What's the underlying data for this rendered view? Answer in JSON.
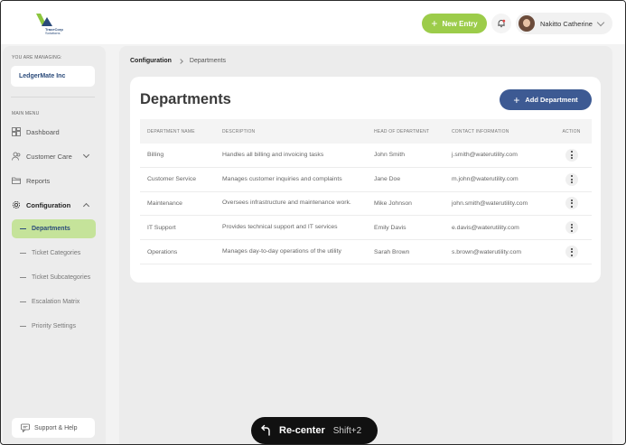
{
  "header": {
    "logo_name": "TraceCorp",
    "logo_tagline": "Solutions",
    "new_entry_label": "New Entry",
    "user_name": "Nakitto Catherine",
    "icons": {
      "bell": "bell-icon",
      "chevron": "chevron-down-icon"
    },
    "accent_color": "#9ccc4a"
  },
  "sidebar": {
    "managing_caption": "YOU ARE MANAGING:",
    "organization": "LedgerMate Inc",
    "menu_caption": "MAIN MENU",
    "items": [
      {
        "label": "Dashboard",
        "icon": "dashboard-icon"
      },
      {
        "label": "Customer Care",
        "icon": "users-icon",
        "expandable": true
      },
      {
        "label": "Reports",
        "icon": "folder-icon"
      },
      {
        "label": "Configuration",
        "icon": "gear-icon",
        "expanded": true
      }
    ],
    "sub_items": [
      {
        "label": "Departments",
        "active": true
      },
      {
        "label": "Ticket Categories"
      },
      {
        "label": "Ticket Subcategories"
      },
      {
        "label": "Escalation Matrix"
      },
      {
        "label": "Priority Settings"
      }
    ],
    "support_label": "Support & Help",
    "active_color": "#c5e39a"
  },
  "breadcrumb": {
    "parent": "Configuration",
    "current": "Departments"
  },
  "page": {
    "title": "Departments",
    "add_button_label": "Add Department",
    "button_color": "#3d5a93"
  },
  "table": {
    "columns": [
      "DEPARTMENT NAME",
      "DESCRIPTION",
      "HEAD OF DEPARTMENT",
      "CONTACT INFORMATION",
      "ACTION"
    ],
    "rows": [
      {
        "name": "Billing",
        "description": "Handles all billing and invoicing tasks",
        "head": "John Smith",
        "contact": "j.smith@waterutility.com"
      },
      {
        "name": "Customer Service",
        "description": "Manages customer inquiries and complaints",
        "head": "Jane Doe",
        "contact": "m.john@waterutility.com"
      },
      {
        "name": "Maintenance",
        "description": "Oversees infrastructure and maintenance work.",
        "head": "Mike Johnson",
        "contact": "john.smith@waterutility.com"
      },
      {
        "name": "IT Support",
        "description": "Provides technical support and IT services",
        "head": "Emily Davis",
        "contact": "e.davis@waterutility.com"
      },
      {
        "name": "Operations",
        "description": "Manages day-to-day operations of the utility",
        "head": "Sarah Brown",
        "contact": "s.brown@waterutility.com"
      }
    ]
  },
  "recenter": {
    "label": "Re-center",
    "shortcut": "Shift+2",
    "icon": "undo-arrow-icon"
  }
}
